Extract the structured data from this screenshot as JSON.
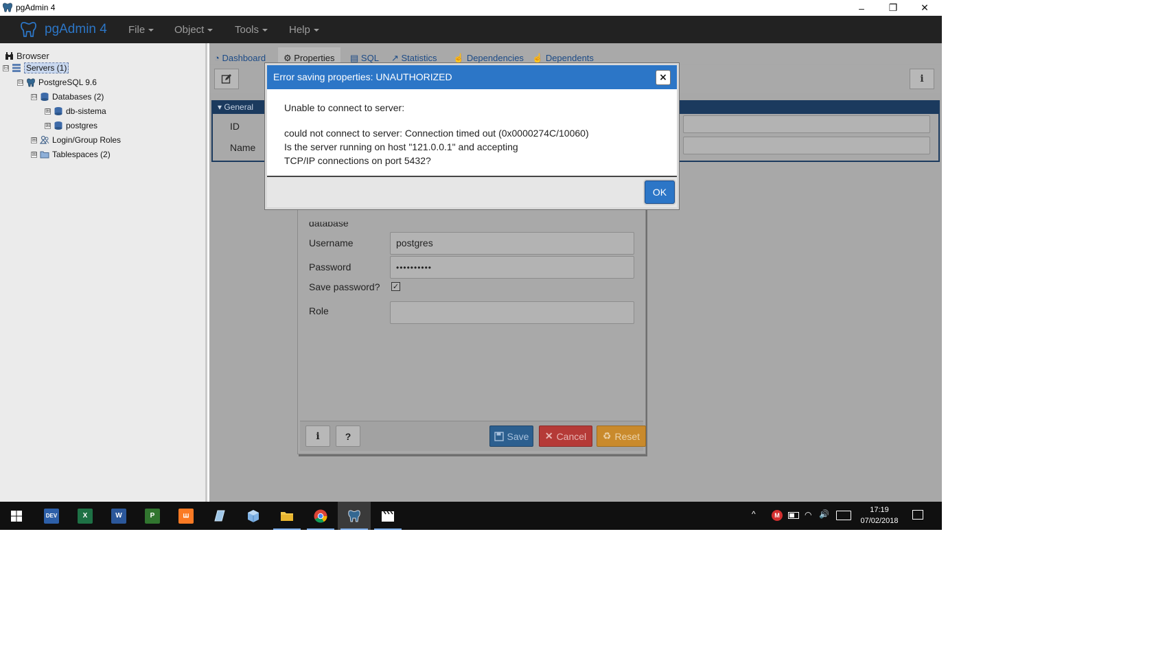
{
  "window": {
    "title": "pgAdmin 4",
    "controls": {
      "minimize": "–",
      "restore": "❐",
      "close": "✕"
    }
  },
  "navbar": {
    "brand": "pgAdmin 4",
    "menus": [
      "File",
      "Object",
      "Tools",
      "Help"
    ]
  },
  "browser": {
    "header": "Browser",
    "tree": [
      {
        "label": "Servers (1)",
        "icon": "servers-icon",
        "expander": "⊟"
      },
      {
        "label": "PostgreSQL 9.6",
        "icon": "elephant-icon",
        "expander": "⊟"
      },
      {
        "label": "Databases (2)",
        "icon": "database-icon",
        "expander": "⊟"
      },
      {
        "label": "db-sistema",
        "icon": "database-icon",
        "expander": "⊞"
      },
      {
        "label": "postgres",
        "icon": "database-icon",
        "expander": "⊞"
      },
      {
        "label": "Login/Group Roles",
        "icon": "roles-icon",
        "expander": "⊞"
      },
      {
        "label": "Tablespaces (2)",
        "icon": "folder-icon",
        "expander": "⊞"
      }
    ]
  },
  "content": {
    "tabs": [
      "Dashboard",
      "Properties",
      "SQL",
      "Statistics",
      "Dependencies",
      "Dependents"
    ],
    "general_label": "General",
    "fields": {
      "id_label": "ID",
      "name_label": "Name"
    }
  },
  "connect_dialog": {
    "partial_label": "database",
    "username_label": "Username",
    "username_value": "postgres",
    "password_label": "Password",
    "password_value": "••••••••••",
    "save_password_label": "Save password?",
    "save_password_checked": "✓",
    "role_label": "Role",
    "buttons": {
      "info": "i",
      "help": "?",
      "save": "Save",
      "cancel": "Cancel",
      "reset": "Reset"
    }
  },
  "error_modal": {
    "title": "Error saving properties: UNAUTHORIZED",
    "close": "×",
    "line1": "Unable to connect to server:",
    "line2": "could not connect to server: Connection timed out (0x0000274C/10060)",
    "line3": "Is the server running on host \"121.0.0.1\" and accepting",
    "line4": "TCP/IP connections on port 5432?",
    "ok": "OK"
  },
  "taskbar": {
    "apps": [
      {
        "name": "windows-start-icon",
        "text": ""
      },
      {
        "name": "dev-app-icon",
        "text": "DEV"
      },
      {
        "name": "excel-icon",
        "text": "X"
      },
      {
        "name": "word-icon",
        "text": "W"
      },
      {
        "name": "project-icon",
        "text": "P"
      },
      {
        "name": "xampp-icon",
        "text": "ꟺ"
      },
      {
        "name": "notepad-icon",
        "text": ""
      },
      {
        "name": "cube-app-icon",
        "text": ""
      },
      {
        "name": "file-explorer-icon",
        "text": ""
      },
      {
        "name": "chrome-icon",
        "text": ""
      },
      {
        "name": "pgadmin-taskbar-icon",
        "text": ""
      },
      {
        "name": "clapper-icon",
        "text": ""
      }
    ],
    "clock_time": "17:19",
    "clock_date": "07/02/2018"
  },
  "colors": {
    "pgadmin_blue": "#2c76c7",
    "navbar_bg": "#222222",
    "save_btn": "#2c5f8f",
    "cancel_btn": "#b53a37",
    "reset_btn": "#c98a2c"
  }
}
